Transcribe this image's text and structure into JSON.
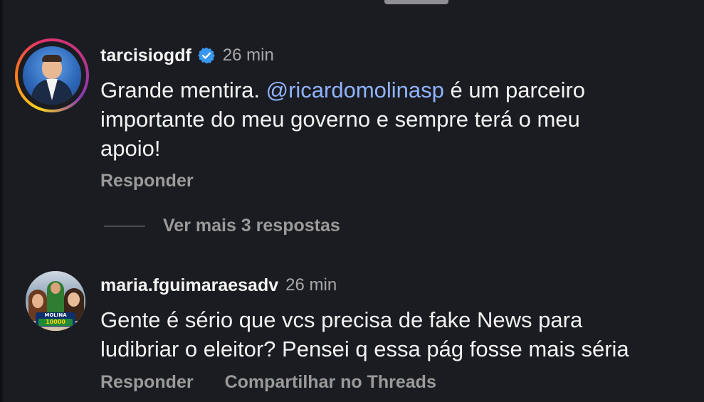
{
  "comments": [
    {
      "username": "tarcisiogdf",
      "verified": true,
      "time": "26 min",
      "text_parts": [
        "Grande mentira. ",
        "@ricardomolinasp",
        " é um parceiro",
        "importante do meu governo e sempre terá o meu",
        "apoio!"
      ],
      "actions": [
        "Responder"
      ],
      "more_replies": "Ver mais 3 respostas"
    },
    {
      "username": "maria.fguimaraesadv",
      "verified": false,
      "time": "26 min",
      "text_lines": [
        "Gente é sério que vcs precisa de fake News para",
        "ludibriar o eleitor? Pensei q essa pág fosse mais séria"
      ],
      "avatar_banner": [
        "MOLINA",
        "10000"
      ],
      "actions": [
        "Responder",
        "Compartilhar no Threads"
      ]
    }
  ],
  "colors": {
    "background": "#1b1c21",
    "mention": "#8fb3ff",
    "verified": "#3897f0",
    "secondary_text": "#9a9a9a"
  },
  "icons": [
    "verified-badge-icon"
  ]
}
